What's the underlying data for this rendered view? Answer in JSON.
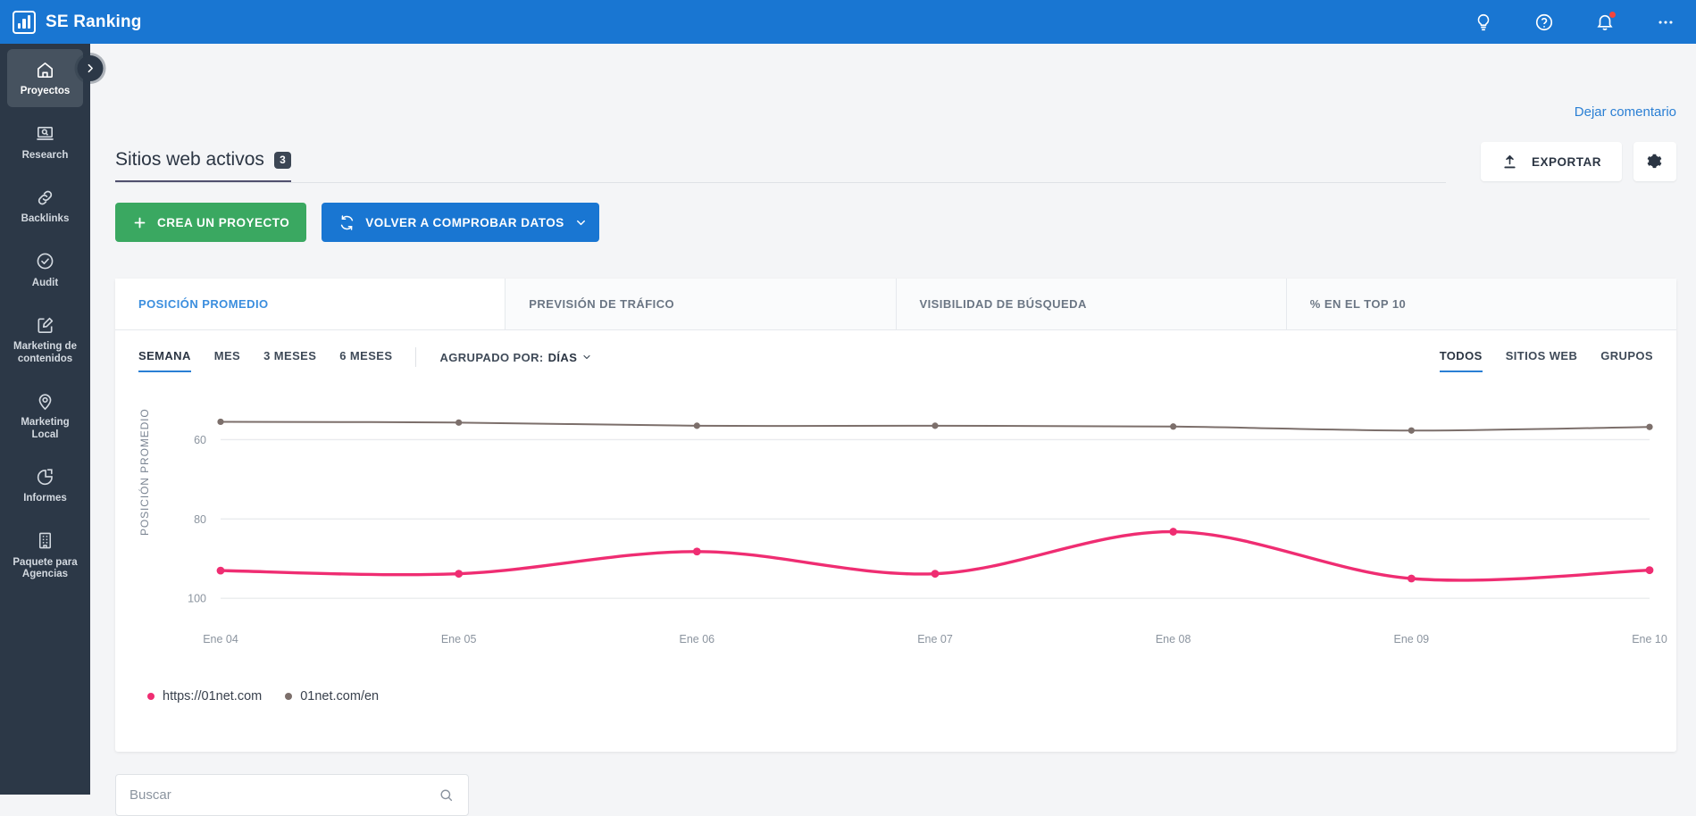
{
  "app": {
    "brand": "SE Ranking",
    "accent_blue": "#1976d2",
    "sidebar_bg": "#2c3847"
  },
  "topbar": {
    "icons": [
      {
        "name": "lightbulb-icon",
        "title": "Ideas"
      },
      {
        "name": "help-icon",
        "title": "Ayuda"
      },
      {
        "name": "notifications-icon",
        "title": "Notificaciones",
        "has_badge": true
      },
      {
        "name": "more-icon",
        "title": "Más"
      }
    ]
  },
  "sidebar": {
    "items": [
      {
        "label": "Proyectos",
        "icon": "home-icon",
        "active": true
      },
      {
        "label": "Research",
        "icon": "laptop-search-icon",
        "active": false
      },
      {
        "label": "Backlinks",
        "icon": "link-icon",
        "active": false
      },
      {
        "label": "Audit",
        "icon": "check-circle-icon",
        "active": false
      },
      {
        "label": "Marketing de contenidos",
        "icon": "pencil-square-icon",
        "active": false
      },
      {
        "label": "Marketing Local",
        "icon": "map-pin-icon",
        "active": false
      },
      {
        "label": "Informes",
        "icon": "pie-chart-icon",
        "active": false
      },
      {
        "label": "Paquete para Agencias",
        "icon": "building-icon",
        "active": false
      }
    ],
    "collapse_label": "›"
  },
  "header": {
    "comment_link": "Dejar comentario",
    "page_title": "Sitios web activos",
    "project_count": "3",
    "export_label": "EXPORTAR",
    "settings_icon": "gear-icon"
  },
  "actions": {
    "create_project": "CREA UN PROYECTO",
    "recheck_data": "VOLVER A COMPROBAR DATOS"
  },
  "metric_tabs": [
    {
      "label": "POSICIÓN PROMEDIO",
      "active": true
    },
    {
      "label": "PREVISIÓN DE TRÁFICO",
      "active": false
    },
    {
      "label": "VISIBILIDAD DE BÚSQUEDA",
      "active": false
    },
    {
      "label": "% EN EL TOP 10",
      "active": false
    }
  ],
  "filters": {
    "periods": [
      {
        "label": "SEMANA",
        "active": true
      },
      {
        "label": "MES",
        "active": false
      },
      {
        "label": "3 MESES",
        "active": false
      },
      {
        "label": "6 MESES",
        "active": false
      }
    ],
    "grouped_by_label": "AGRUPADO POR:",
    "grouped_by_value": "DÍAS",
    "scopes": [
      {
        "label": "TODOS",
        "active": true
      },
      {
        "label": "SITIOS WEB",
        "active": false
      },
      {
        "label": "GRUPOS",
        "active": false
      }
    ]
  },
  "search": {
    "placeholder": "Buscar",
    "value": "",
    "icon": "search-icon"
  },
  "chart_data": {
    "type": "line",
    "title": "",
    "xlabel": "",
    "ylabel": "POSICIÓN PROMEDIO",
    "categories": [
      "Ene 04",
      "Ene 05",
      "Ene 06",
      "Ene 07",
      "Ene 08",
      "Ene 09",
      "Ene 10"
    ],
    "yticks": [
      60,
      80,
      100
    ],
    "ylim": [
      50,
      104
    ],
    "y_inverted": true,
    "grid": true,
    "legend_position": "bottom-left",
    "series": [
      {
        "name": "https://01net.com",
        "color": "#ef2d72",
        "values": [
          93.0,
          93.8,
          88.2,
          93.8,
          83.2,
          95.0,
          92.9
        ]
      },
      {
        "name": "01net.com/en",
        "color": "#7c6f6b",
        "values": [
          55.5,
          55.7,
          56.5,
          56.5,
          56.7,
          57.7,
          56.8
        ]
      }
    ]
  }
}
